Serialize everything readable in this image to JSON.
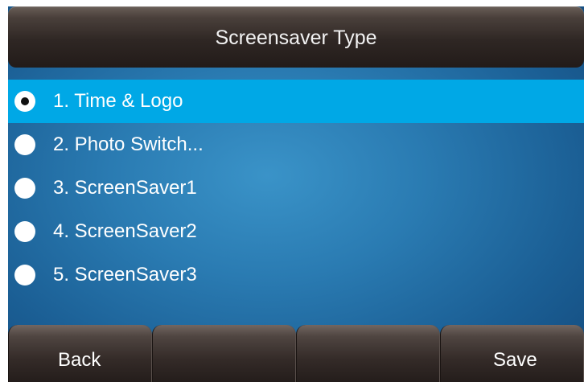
{
  "header": {
    "title": "Screensaver Type"
  },
  "menu": {
    "items": [
      {
        "label": "1. Time & Logo",
        "selected": true
      },
      {
        "label": "2. Photo Switch...",
        "selected": false
      },
      {
        "label": "3. ScreenSaver1",
        "selected": false
      },
      {
        "label": "4. ScreenSaver2",
        "selected": false
      },
      {
        "label": "5. ScreenSaver3",
        "selected": false
      }
    ]
  },
  "softkeys": {
    "back_label": "Back",
    "key2_label": "",
    "key3_label": "",
    "save_label": "Save"
  },
  "colors": {
    "selection_highlight": "#00a8e6",
    "background_blue": "#2a7bb2",
    "bar_dark": "#2f2724",
    "text": "#ffffff"
  }
}
